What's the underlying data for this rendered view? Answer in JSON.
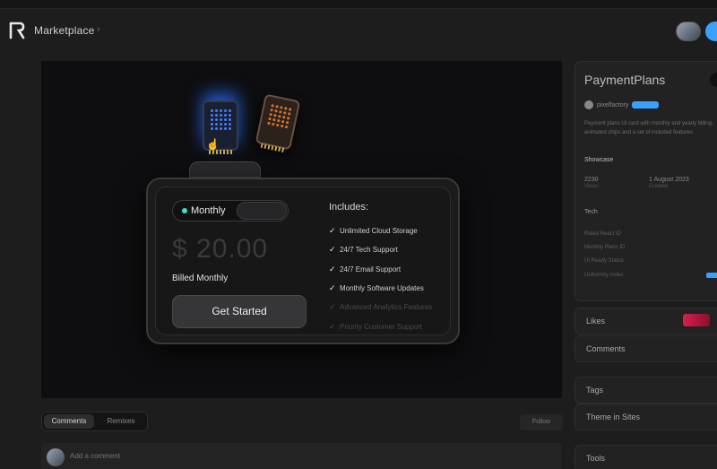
{
  "header": {
    "app_title": "Marketplace",
    "breadcrumb_sep": "›"
  },
  "pricing_card": {
    "billing_toggle_label": "Monthly",
    "price": "$ 20.00",
    "billing_note": "Billed Monthly",
    "cta_label": "Get Started",
    "includes_title": "Includes:",
    "includes": [
      {
        "label": "Unlimited Cloud Storage",
        "enabled": true
      },
      {
        "label": "24/7 Tech Support",
        "enabled": true
      },
      {
        "label": "24/7 Email Support",
        "enabled": true
      },
      {
        "label": "Monthly Software Updates",
        "enabled": true
      },
      {
        "label": "Advanced Analytics Features",
        "enabled": false
      },
      {
        "label": "Priority Customer Support",
        "enabled": false
      }
    ]
  },
  "tabs": {
    "comments": "Comments",
    "remixes": "Remixes",
    "follow": "Follow"
  },
  "comment": {
    "placeholder": "Add a comment"
  },
  "side_panel": {
    "title": "PaymentPlans",
    "author": "pixelfactory",
    "description": "Payment plans UI card with monthly and yearly billing, animated chips and a set of included features.",
    "showcase_label": "Showcase",
    "stats": [
      "2230",
      "1 August 2023"
    ],
    "stat_labels": [
      "Views",
      "Created"
    ],
    "tech_label": "Tech",
    "rows": [
      {
        "label": "Rated React ID",
        "value": ""
      },
      {
        "label": "Monthly Plans ID",
        "value": ""
      },
      {
        "label": "UI Ready Status",
        "value": ""
      },
      {
        "label": "Uniformity Index",
        "value": ""
      }
    ],
    "likes_label": "Likes",
    "comments_label": "Comments",
    "tags_label": "Tags",
    "theme_label": "Theme in Sites",
    "bottom_label": "Tools"
  },
  "colors": {
    "accent": "#3aa0ff",
    "toggle_dot": "#3fe2c5",
    "chip_glow": "#2f6bff",
    "chip_orange": "#d2752f"
  }
}
